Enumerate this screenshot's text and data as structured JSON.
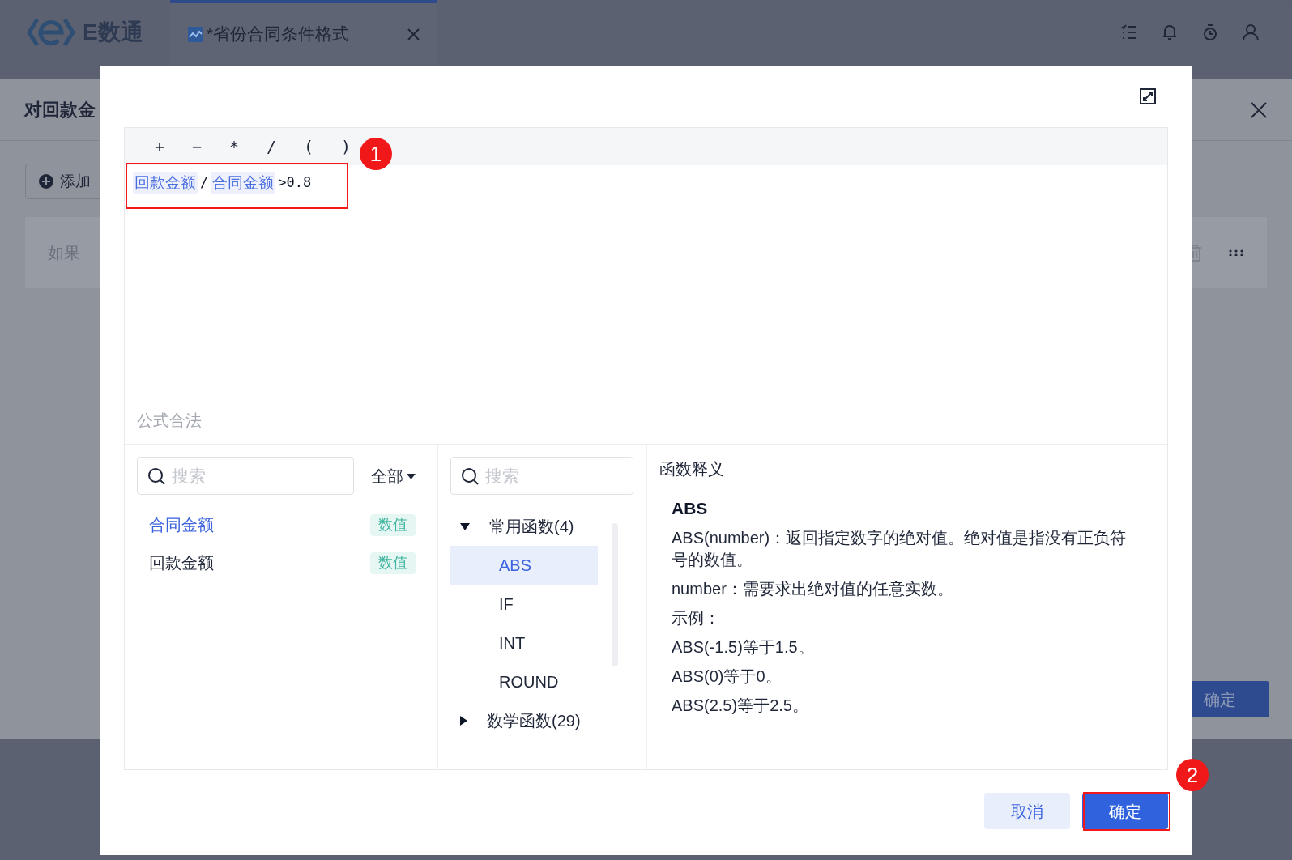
{
  "app": {
    "logo_text": "E数通"
  },
  "tabs": [
    {
      "label": "*省份合同条件格式",
      "selected": true
    }
  ],
  "background_panel": {
    "title": "对回款金",
    "add_button": "添加",
    "row_label": "如果",
    "confirm": "确定"
  },
  "dialog": {
    "operators": [
      "+",
      "−",
      "*",
      "/",
      "(",
      ")"
    ],
    "formula": [
      {
        "kind": "field",
        "text": "回款金额"
      },
      {
        "kind": "op",
        "text": "/"
      },
      {
        "kind": "field",
        "text": "合同金额"
      },
      {
        "kind": "op",
        "text": ">0.8"
      }
    ],
    "status": "公式合法",
    "fields": {
      "search": {
        "placeholder": "搜索"
      },
      "filter": "全部",
      "items": [
        {
          "name": "合同金额",
          "type": "数值",
          "selected": true
        },
        {
          "name": "回款金额",
          "type": "数值",
          "selected": false
        }
      ]
    },
    "functions": {
      "search": {
        "placeholder": "搜索"
      },
      "groups": [
        {
          "label": "常用函数(4)",
          "expanded": true,
          "children": [
            {
              "label": "ABS",
              "selected": true
            },
            {
              "label": "IF",
              "selected": false
            },
            {
              "label": "INT",
              "selected": false
            },
            {
              "label": "ROUND",
              "selected": false
            }
          ]
        },
        {
          "label": "数学函数(29)",
          "expanded": false
        }
      ]
    },
    "description": {
      "heading": "函数释义",
      "name": "ABS",
      "lines": [
        "ABS(number)：返回指定数字的绝对值。绝对值是指没有正负符号的数值。",
        "number：需要求出绝对值的任意实数。",
        "示例：",
        "ABS(-1.5)等于1.5。",
        "ABS(0)等于0。",
        "ABS(2.5)等于2.5。"
      ]
    },
    "buttons": [
      {
        "kind": "secondary",
        "label": "取消"
      },
      {
        "kind": "primary",
        "label": "确定"
      }
    ]
  },
  "annotations": [
    "1",
    "2"
  ]
}
